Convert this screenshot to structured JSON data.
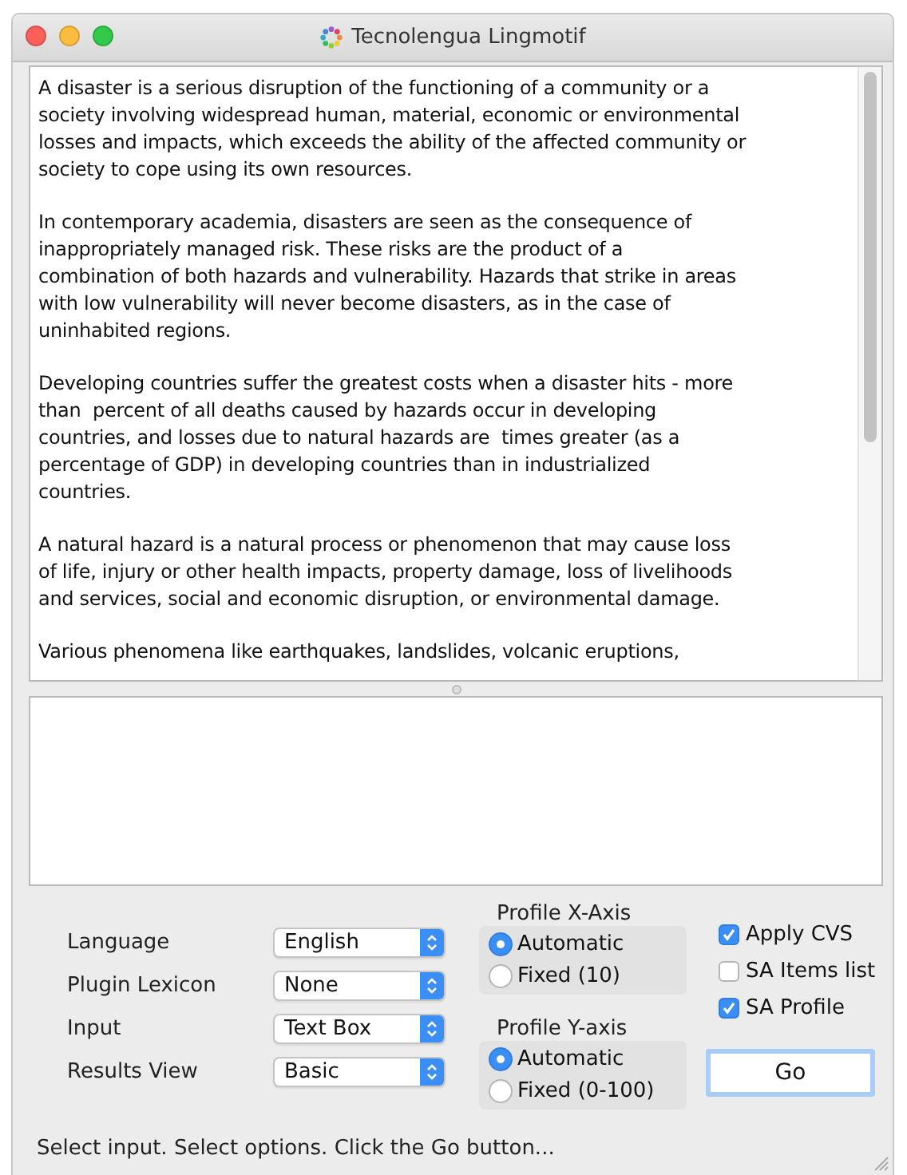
{
  "window": {
    "title": "Tecnolengua Lingmotif"
  },
  "text_area": {
    "paragraphs": [
      [
        "A disaster is a serious disruption of the functioning of a community or a",
        "society involving widespread human, material, economic or environmental",
        "losses and impacts, which exceeds the ability of the affected community or",
        "society to cope using its own resources."
      ],
      [
        "In contemporary academia, disasters are seen as the consequence of",
        "inappropriately managed risk. These risks are the product of a",
        "combination of both hazards and vulnerability. Hazards that strike in areas",
        "with low vulnerability will never become disasters, as in the case of",
        "uninhabited regions."
      ],
      [
        "Developing countries suffer the greatest costs when a disaster hits - more",
        "than  percent of all deaths caused by hazards occur in developing",
        "countries, and losses due to natural hazards are  times greater (as a",
        "percentage of GDP) in developing countries than in industrialized",
        "countries."
      ],
      [
        "A natural hazard is a natural process or phenomenon that may cause loss",
        "of life, injury or other health impacts, property damage, loss of livelihoods",
        "and services, social and economic disruption, or environmental damage."
      ],
      [
        "Various phenomena like earthquakes, landslides, volcanic eruptions,"
      ]
    ]
  },
  "options": [
    {
      "label": "Language",
      "value": "English"
    },
    {
      "label": "Plugin Lexicon",
      "value": "None"
    },
    {
      "label": "Input",
      "value": "Text Box"
    },
    {
      "label": "Results View",
      "value": "Basic"
    }
  ],
  "radio_groups": [
    {
      "title": "Profile X-Axis",
      "options": [
        {
          "label": "Automatic",
          "selected": true
        },
        {
          "label": "Fixed (10)",
          "selected": false
        }
      ]
    },
    {
      "title": "Profile Y-axis",
      "options": [
        {
          "label": "Automatic",
          "selected": true
        },
        {
          "label": "Fixed (0-100)",
          "selected": false
        }
      ]
    }
  ],
  "checkboxes": [
    {
      "label": "Apply CVS",
      "checked": true
    },
    {
      "label": "SA Items list",
      "checked": false
    },
    {
      "label": "SA Profile",
      "checked": true
    }
  ],
  "go_button": "Go",
  "status_bar": "Select input. Select options. Click the Go button..."
}
